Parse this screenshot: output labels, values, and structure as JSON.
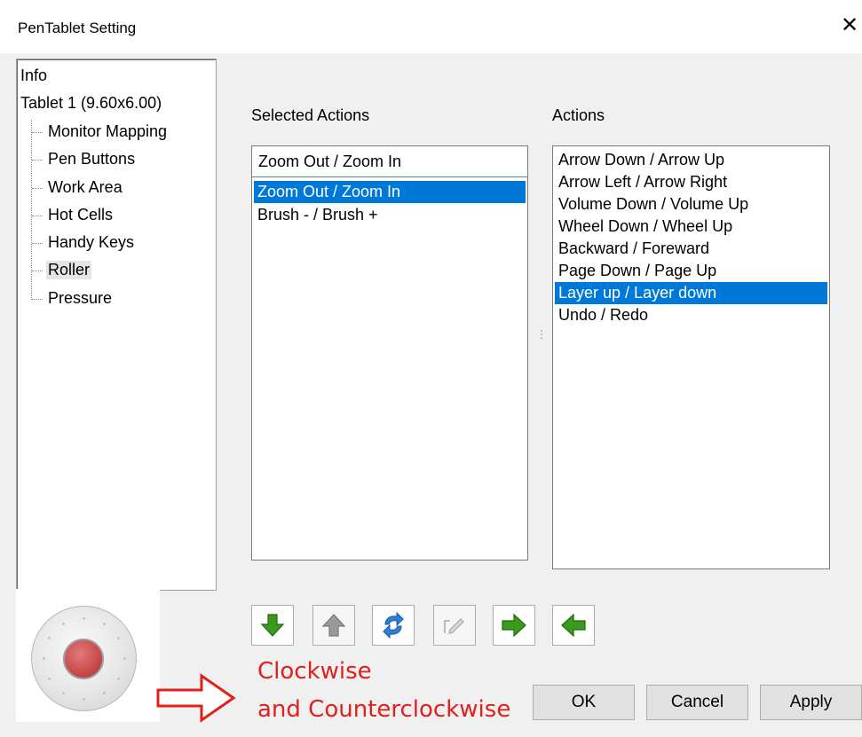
{
  "window": {
    "title": "PenTablet Setting",
    "close_glyph": "✕"
  },
  "tree": {
    "root_items": [
      "Info",
      "Tablet  1 (9.60x6.00)"
    ],
    "children": [
      "Monitor Mapping",
      "Pen Buttons",
      "Work Area",
      "Hot Cells",
      "Handy Keys",
      "Roller",
      "Pressure"
    ],
    "selected": "Roller"
  },
  "selected_actions": {
    "label": "Selected Actions",
    "current_value": "Zoom Out / Zoom In",
    "items": [
      "Zoom Out / Zoom In",
      "Brush -  / Brush +"
    ],
    "selected_index": 0
  },
  "actions": {
    "label": "Actions",
    "items": [
      "Arrow Down / Arrow Up",
      "Arrow Left / Arrow Right",
      "Volume Down / Volume Up",
      "Wheel Down / Wheel Up",
      "Backward / Foreward",
      "Page Down / Page Up",
      "Layer up / Layer down",
      "Undo / Redo"
    ],
    "selected_index": 6
  },
  "toolbar": {
    "buttons": [
      {
        "icon": "green-arrow-down-icon",
        "enabled": true
      },
      {
        "icon": "gray-arrow-up-icon",
        "enabled": false
      },
      {
        "icon": "blue-swap-icon",
        "enabled": true
      },
      {
        "icon": "edit-pen-icon",
        "enabled": false
      },
      {
        "icon": "green-arrow-right-icon",
        "enabled": true
      },
      {
        "icon": "green-arrow-left-icon",
        "enabled": true
      }
    ]
  },
  "buttons": {
    "ok": "OK",
    "cancel": "Cancel",
    "apply": "Apply"
  },
  "annotation": {
    "line1": "Clockwise",
    "line2": "and Counterclockwise",
    "color": "#e0201b"
  },
  "colors": {
    "selection": "#0078d7",
    "annotation": "#e0201b",
    "arrow_green": "#3a9a1e"
  }
}
